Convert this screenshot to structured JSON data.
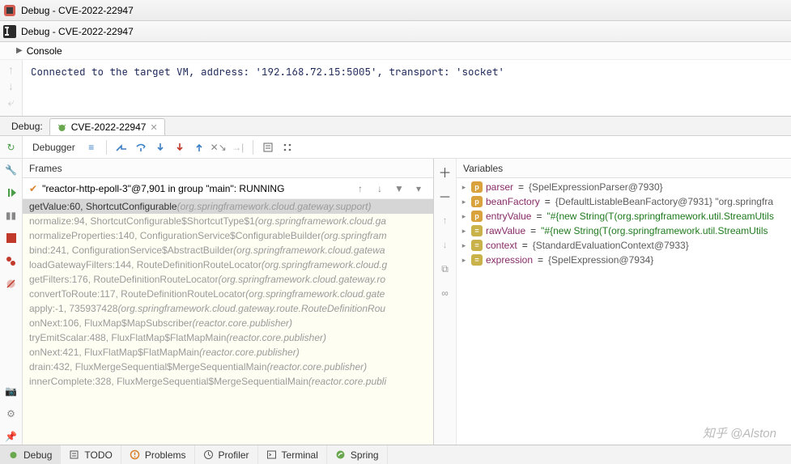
{
  "titlebar": {
    "text": "Debug - CVE-2022-22947",
    "innerText": "Debug - CVE-2022-22947"
  },
  "console": {
    "label": "Console",
    "output": "Connected to the target VM, address: '192.168.72.15:5005', transport: 'socket'"
  },
  "debugStrip": {
    "label": "Debug:",
    "tab": "CVE-2022-22947"
  },
  "toolbar": {
    "debuggerLabel": "Debugger"
  },
  "frames": {
    "header": "Frames",
    "thread": "\"reactor-http-epoll-3\"@7,901 in group \"main\": RUNNING",
    "stack": [
      {
        "method": "getValue:60, ShortcutConfigurable",
        "pkg": "(org.springframework.cloud.gateway.support)",
        "selected": true,
        "dim": false
      },
      {
        "method": "normalize:94, ShortcutConfigurable$ShortcutType$1",
        "pkg": "(org.springframework.cloud.ga",
        "dim": true
      },
      {
        "method": "normalizeProperties:140, ConfigurationService$ConfigurableBuilder",
        "pkg": "(org.springfram",
        "dim": true
      },
      {
        "method": "bind:241, ConfigurationService$AbstractBuilder",
        "pkg": "(org.springframework.cloud.gatewa",
        "dim": true
      },
      {
        "method": "loadGatewayFilters:144, RouteDefinitionRouteLocator",
        "pkg": "(org.springframework.cloud.g",
        "dim": true
      },
      {
        "method": "getFilters:176, RouteDefinitionRouteLocator",
        "pkg": "(org.springframework.cloud.gateway.ro",
        "dim": true
      },
      {
        "method": "convertToRoute:117, RouteDefinitionRouteLocator",
        "pkg": "(org.springframework.cloud.gate",
        "dim": true
      },
      {
        "method": "apply:-1, 735937428",
        "pkg": "(org.springframework.cloud.gateway.route.RouteDefinitionRou",
        "dim": true
      },
      {
        "method": "onNext:106, FluxMap$MapSubscriber",
        "pkg": "(reactor.core.publisher)",
        "dim": true
      },
      {
        "method": "tryEmitScalar:488, FluxFlatMap$FlatMapMain",
        "pkg": "(reactor.core.publisher)",
        "dim": true
      },
      {
        "method": "onNext:421, FluxFlatMap$FlatMapMain",
        "pkg": "(reactor.core.publisher)",
        "dim": true
      },
      {
        "method": "drain:432, FluxMergeSequential$MergeSequentialMain",
        "pkg": "(reactor.core.publisher)",
        "dim": true
      },
      {
        "method": "innerComplete:328, FluxMergeSequential$MergeSequentialMain",
        "pkg": "(reactor.core.publi",
        "dim": true
      }
    ]
  },
  "variables": {
    "header": "Variables",
    "items": [
      {
        "icon": "p",
        "name": "parser",
        "value": "{SpelExpressionParser@7930}",
        "type": "obj"
      },
      {
        "icon": "p",
        "name": "beanFactory",
        "value": "{DefaultListableBeanFactory@7931}  \"org.springfra",
        "type": "obj"
      },
      {
        "icon": "p",
        "name": "entryValue",
        "value": "\"#{new String(T(org.springframework.util.StreamUtils",
        "type": "str"
      },
      {
        "icon": "eq",
        "name": "rawValue",
        "value": "\"#{new String(T(org.springframework.util.StreamUtils",
        "type": "str"
      },
      {
        "icon": "eq",
        "name": "context",
        "value": "{StandardEvaluationContext@7933}",
        "type": "obj"
      },
      {
        "icon": "eq",
        "name": "expression",
        "value": "{SpelExpression@7934}",
        "type": "obj"
      }
    ]
  },
  "bottomBar": {
    "tabs": [
      {
        "label": "Debug",
        "icon": "bug",
        "active": true
      },
      {
        "label": "TODO",
        "icon": "todo"
      },
      {
        "label": "Problems",
        "icon": "problems"
      },
      {
        "label": "Profiler",
        "icon": "profiler"
      },
      {
        "label": "Terminal",
        "icon": "terminal"
      },
      {
        "label": "Spring",
        "icon": "spring"
      }
    ]
  },
  "watermark": "知乎 @Alston"
}
